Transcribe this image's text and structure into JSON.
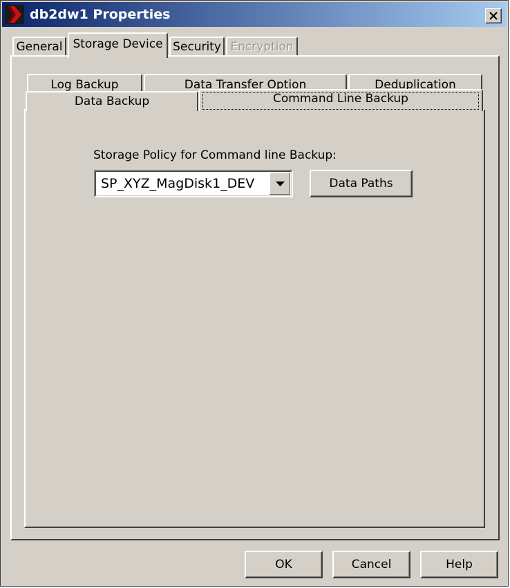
{
  "window": {
    "title": "db2dw1 Properties",
    "icon": "red-chevron-app-icon",
    "close_icon": "close-x-icon"
  },
  "tabs": [
    {
      "label": "General",
      "state": "normal"
    },
    {
      "label": "Storage Device",
      "state": "active"
    },
    {
      "label": "Security",
      "state": "normal"
    },
    {
      "label": "Encryption",
      "state": "disabled"
    }
  ],
  "subtabs": {
    "back_row": [
      {
        "label": "Log Backup"
      },
      {
        "label": "Data Transfer Option"
      },
      {
        "label": "Deduplication"
      }
    ],
    "front_row": [
      {
        "label": "Data Backup"
      },
      {
        "label": "Command Line Backup",
        "active": true
      }
    ]
  },
  "form": {
    "policy_label": "Storage Policy for Command line Backup:",
    "policy_value": "SP_XYZ_MagDisk1_DEV",
    "data_paths_label": "Data Paths"
  },
  "footer": {
    "ok_label": "OK",
    "cancel_label": "Cancel",
    "help_label": "Help"
  },
  "colors": {
    "dialog_face": "#d4d0c8",
    "titlebar_start": "#0a246a",
    "titlebar_end": "#a6caf0",
    "icon_red": "#cc1111"
  }
}
